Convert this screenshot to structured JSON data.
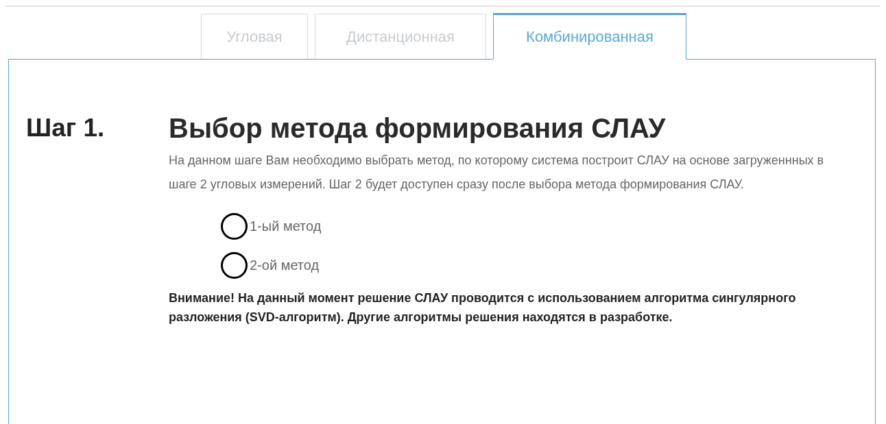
{
  "tabs": [
    {
      "label": "Угловая",
      "selected": false
    },
    {
      "label": "Дистанционная",
      "selected": false
    },
    {
      "label": "Комбинированная",
      "selected": true
    }
  ],
  "step": {
    "number": "Шаг 1.",
    "title": "Выбор метода формирования СЛАУ",
    "description": "На данном шаге Вам необходимо выбрать метод, по которому система построит СЛАУ на основе загруженнных в шаге 2 угловых измерений. Шаг 2 будет доступен сразу после выбора метода формирования СЛАУ.",
    "options": [
      {
        "label": "1-ый метод",
        "selected": false
      },
      {
        "label": "2-ой метод",
        "selected": false
      }
    ],
    "warning": "Внимание! На данный момент решение СЛАУ проводится с использованием алгоритма сингулярного разложения (SVD-алгоритм). Другие алгоритмы решения находятся в разработке."
  }
}
